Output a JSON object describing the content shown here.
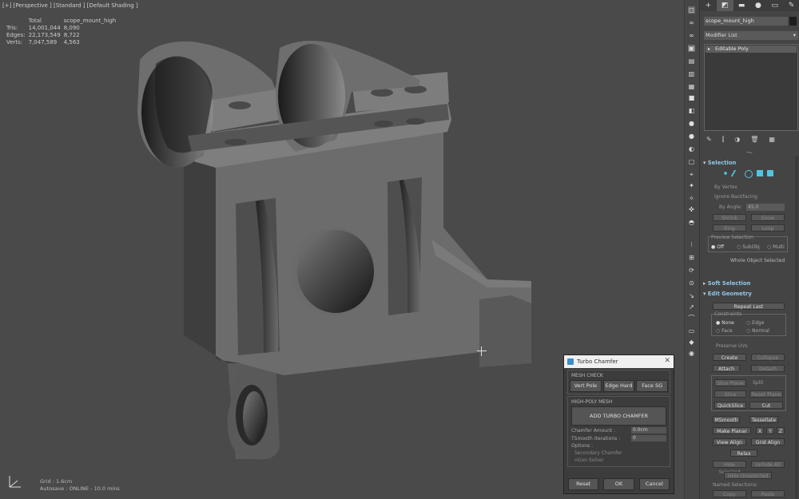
{
  "viewport": {
    "label": "[+] [Perspective ] [Standard ] [Default Shading ]",
    "stats": {
      "header": [
        "Total",
        "scope_mount_high"
      ],
      "rows": [
        {
          "label": "Tris:",
          "total": "14,001,044",
          "sel": "8,090"
        },
        {
          "label": "Edges:",
          "total": "22,173,549",
          "sel": "8,722"
        },
        {
          "label": "Verts:",
          "total": "7,047,589",
          "sel": "4,563"
        }
      ]
    },
    "grid": "Grid : 1.6cm",
    "autosave": "Autosave : ONLINE - 10.0 mins",
    "model_color": "#6a6a6a"
  },
  "dialog": {
    "title": "Turbo Chamfer",
    "mesh_check": {
      "label": "MESH CHECK",
      "buttons": [
        "Vert Pole",
        "Edge Hard",
        "Face SG"
      ]
    },
    "high_poly": {
      "label": "HIGH-POLY MESH",
      "add_button": "ADD TURBO CHAMFER",
      "chamfer_amount_label": "Chamfer Amount :",
      "chamfer_amount_value": "0.0cm",
      "tsmooth_label": "TSmooth Iterations :",
      "tsmooth_value": "0",
      "options_label": "Options :",
      "option1": "Secondary Chamfer",
      "option2": "nGon Solver"
    },
    "reset": "Reset",
    "ok": "OK",
    "cancel": "Cancel"
  },
  "panel": {
    "object_name": "scope_mount_high",
    "modifier_list": "Modifier List",
    "stack_item": "Editable Poly",
    "selection": {
      "title": "Selection",
      "by_vertex": "By Vertex",
      "ignore_backfacing": "Ignore Backfacing",
      "by_angle": "By Angle:",
      "angle_value": "45.0",
      "shrink": "Shrink",
      "grow": "Grow",
      "ring": "Ring",
      "loop": "Loop",
      "preview_selection": "Preview Selection",
      "off": "Off",
      "subobj": "SubObj",
      "multi": "Multi",
      "status": "Whole Object Selected"
    },
    "soft_selection": "Soft Selection",
    "edit_geometry": {
      "title": "Edit Geometry",
      "repeat_last": "Repeat Last",
      "constraints": "Constraints",
      "none": "None",
      "edge": "Edge",
      "face": "Face",
      "normal": "Normal",
      "preserve_uvs": "Preserve UVs",
      "create": "Create",
      "collapse": "Collapse",
      "attach": "Attach",
      "detach": "Detach",
      "slice_plane": "Slice Plane",
      "split": "Split",
      "slice": "Slice",
      "reset_plane": "Reset Plane",
      "quickslice": "QuickSlice",
      "cut": "Cut",
      "msmooth": "MSmooth",
      "tessellate": "Tessellate",
      "make_planar": "Make Planar",
      "x": "X",
      "y": "Y",
      "z": "Z",
      "view_align": "View Align",
      "grid_align": "Grid Align",
      "relax": "Relax",
      "hide_selected": "Hide Selected",
      "unhide_all": "Unhide All",
      "hide_unselected": "Hide Unselected",
      "named_selections": "Named Selections:",
      "copy": "Copy",
      "paste": "Paste"
    }
  }
}
